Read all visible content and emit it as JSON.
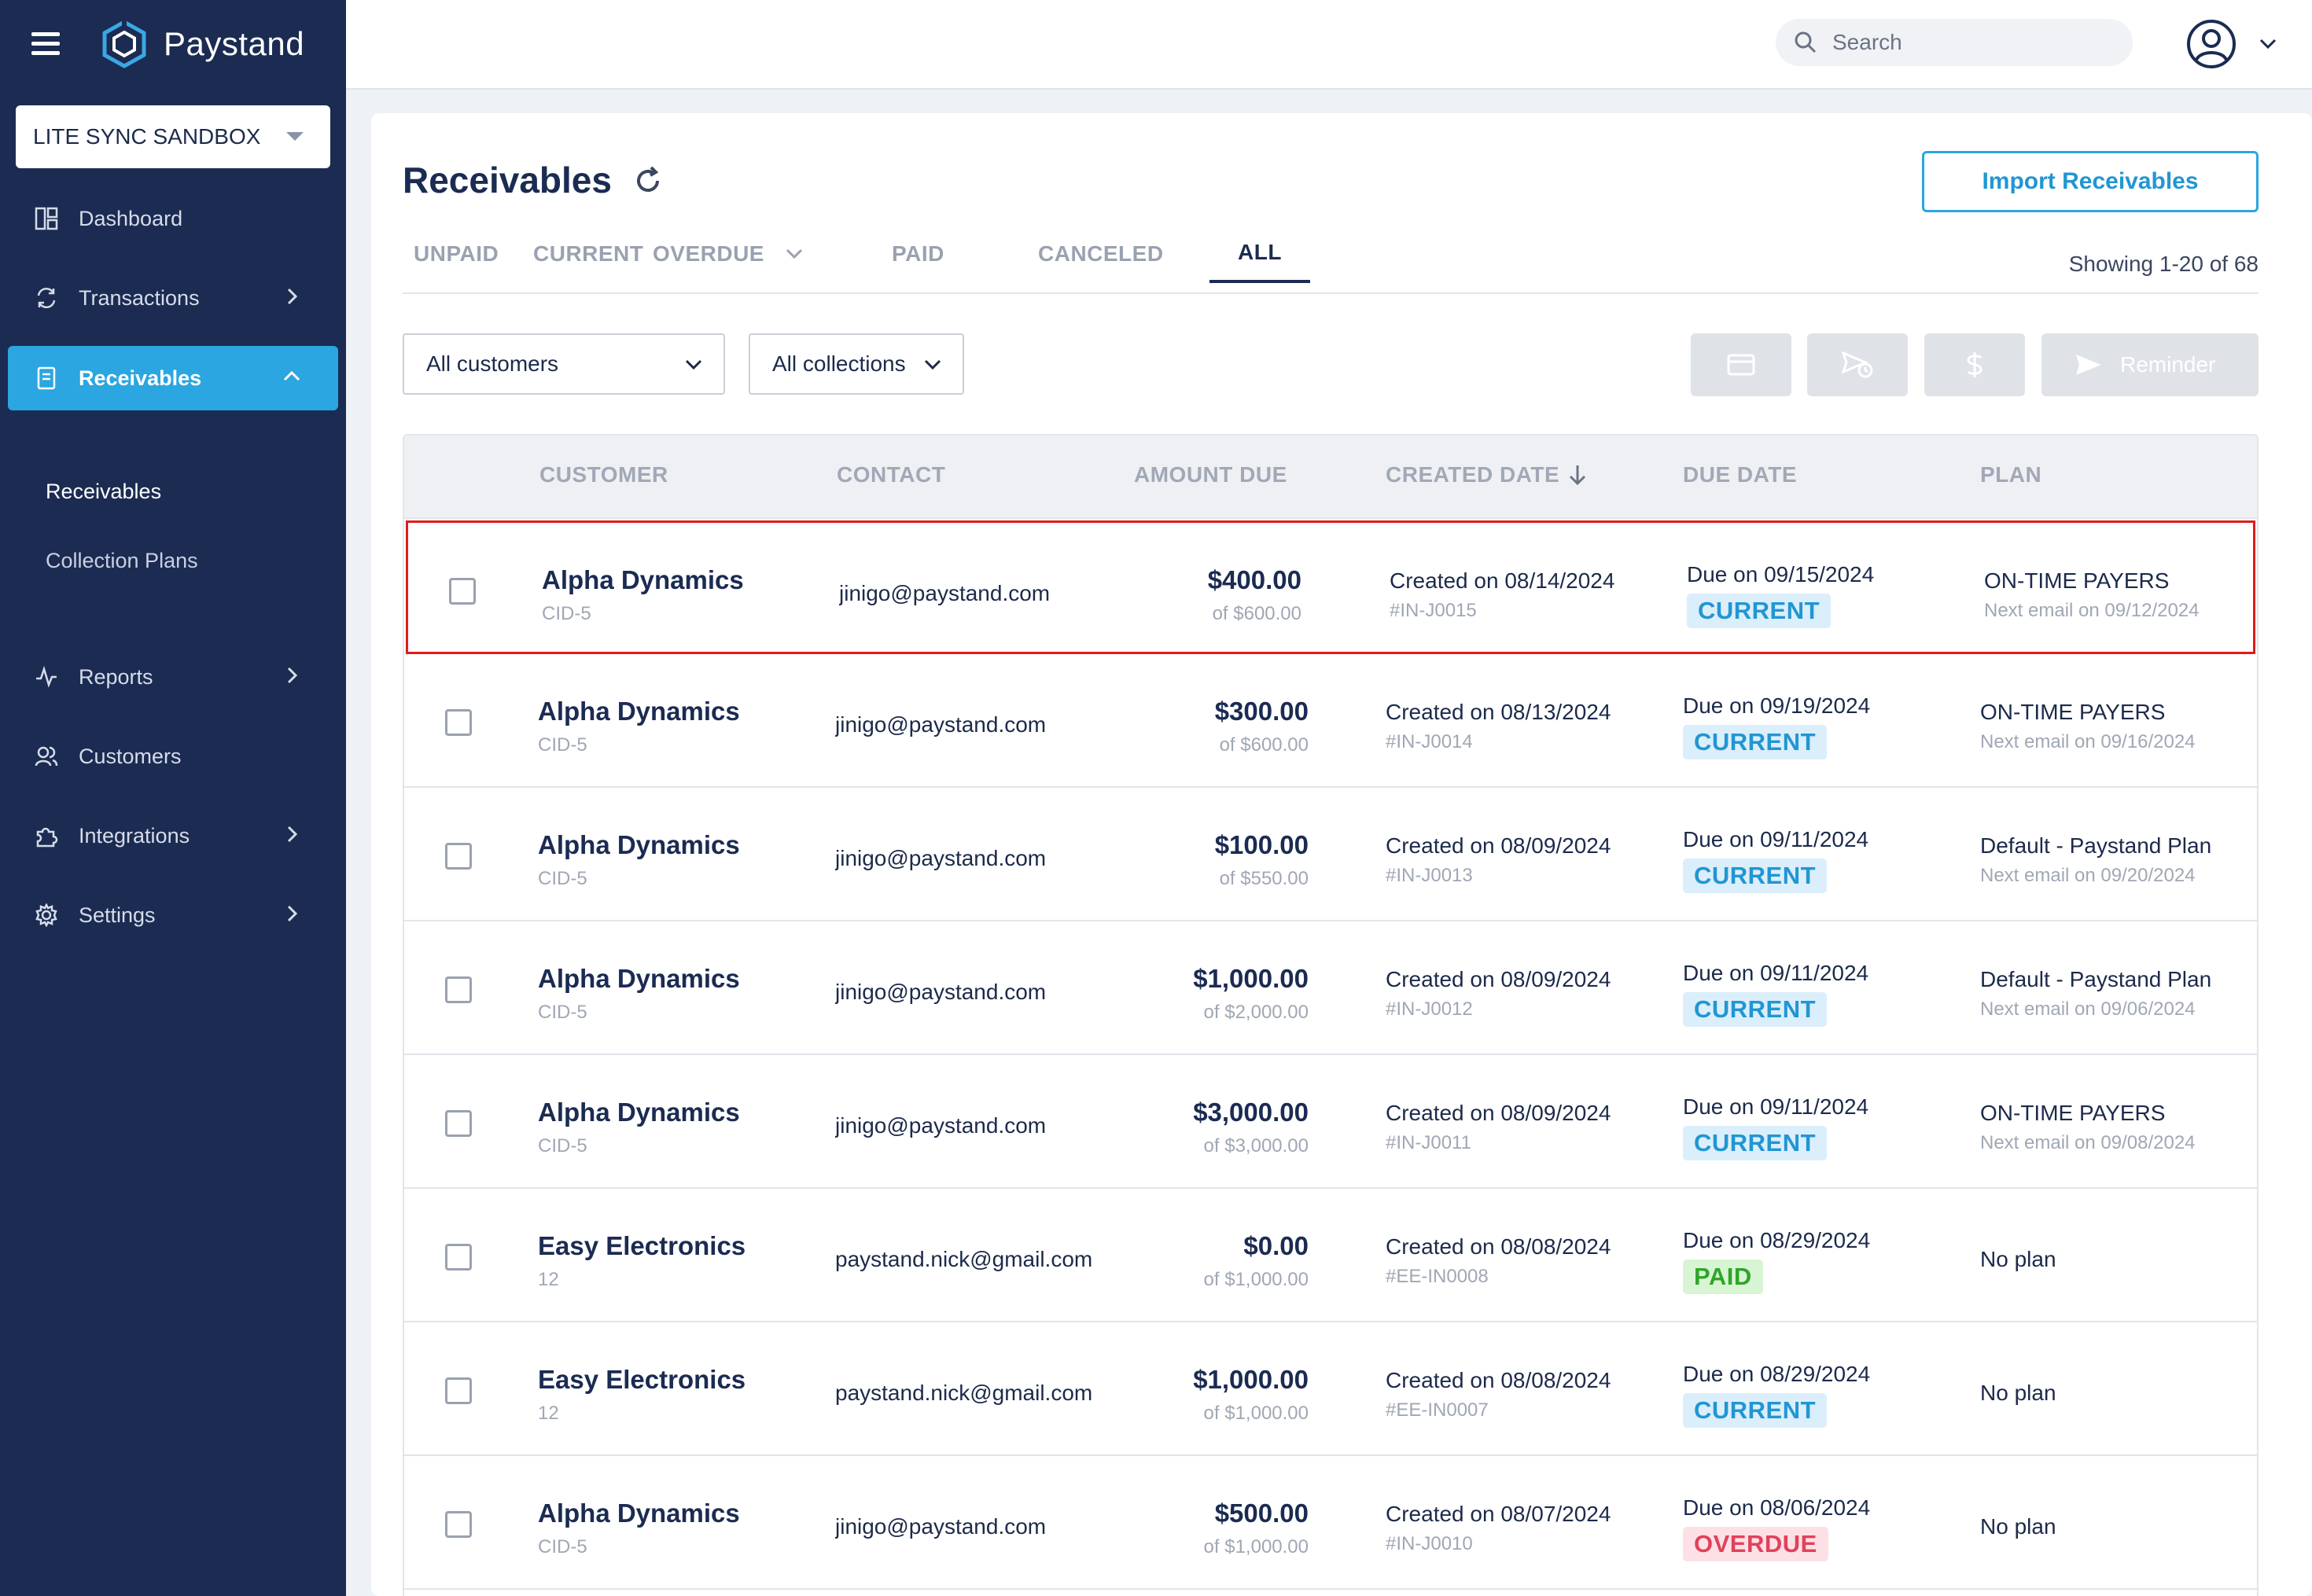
{
  "brand": {
    "name": "Paystand"
  },
  "org": {
    "selected": "LITE SYNC SANDBOX"
  },
  "nav": {
    "dashboard": "Dashboard",
    "transactions": "Transactions",
    "receivables": "Receivables",
    "sub_receivables": "Receivables",
    "sub_collection_plans": "Collection Plans",
    "reports": "Reports",
    "customers": "Customers",
    "integrations": "Integrations",
    "settings": "Settings"
  },
  "search": {
    "placeholder": "Search"
  },
  "page": {
    "title": "Receivables",
    "import_button": "Import Receivables",
    "showing": "Showing 1-20 of 68"
  },
  "tabs": [
    "UNPAID",
    "CURRENT",
    "OVERDUE",
    "PAID",
    "CANCELED",
    "ALL"
  ],
  "active_tab": "ALL",
  "filters": {
    "customers": "All customers",
    "collections": "All collections"
  },
  "actions": {
    "reminder": "Reminder"
  },
  "table": {
    "headers": {
      "customer": "CUSTOMER",
      "contact": "CONTACT",
      "amount_due": "AMOUNT DUE",
      "created_date": "CREATED DATE",
      "due_date": "DUE DATE",
      "plan": "PLAN"
    },
    "rows": [
      {
        "name": "Alpha Dynamics",
        "id": "CID-5",
        "contact": "jinigo@paystand.com",
        "amount": "$400.00",
        "of": "of $600.00",
        "created": "Created on 08/14/2024",
        "invoice": "#IN-J0015",
        "due": "Due on 09/15/2024",
        "status": "CURRENT",
        "plan": "ON-TIME PAYERS",
        "next": "Next email on 09/12/2024"
      },
      {
        "name": "Alpha Dynamics",
        "id": "CID-5",
        "contact": "jinigo@paystand.com",
        "amount": "$300.00",
        "of": "of $600.00",
        "created": "Created on 08/13/2024",
        "invoice": "#IN-J0014",
        "due": "Due on 09/19/2024",
        "status": "CURRENT",
        "plan": "ON-TIME PAYERS",
        "next": "Next email on 09/16/2024"
      },
      {
        "name": "Alpha Dynamics",
        "id": "CID-5",
        "contact": "jinigo@paystand.com",
        "amount": "$100.00",
        "of": "of $550.00",
        "created": "Created on 08/09/2024",
        "invoice": "#IN-J0013",
        "due": "Due on 09/11/2024",
        "status": "CURRENT",
        "plan": "Default - Paystand Plan",
        "next": "Next email on 09/20/2024"
      },
      {
        "name": "Alpha Dynamics",
        "id": "CID-5",
        "contact": "jinigo@paystand.com",
        "amount": "$1,000.00",
        "of": "of $2,000.00",
        "created": "Created on 08/09/2024",
        "invoice": "#IN-J0012",
        "due": "Due on 09/11/2024",
        "status": "CURRENT",
        "plan": "Default - Paystand Plan",
        "next": "Next email on 09/06/2024"
      },
      {
        "name": "Alpha Dynamics",
        "id": "CID-5",
        "contact": "jinigo@paystand.com",
        "amount": "$3,000.00",
        "of": "of $3,000.00",
        "created": "Created on 08/09/2024",
        "invoice": "#IN-J0011",
        "due": "Due on 09/11/2024",
        "status": "CURRENT",
        "plan": "ON-TIME PAYERS",
        "next": "Next email on 09/08/2024"
      },
      {
        "name": "Easy Electronics",
        "id": "12",
        "contact": "paystand.nick@gmail.com",
        "amount": "$0.00",
        "of": "of $1,000.00",
        "created": "Created on 08/08/2024",
        "invoice": "#EE-IN0008",
        "due": "Due on 08/29/2024",
        "status": "PAID",
        "plan": "No plan",
        "next": ""
      },
      {
        "name": "Easy Electronics",
        "id": "12",
        "contact": "paystand.nick@gmail.com",
        "amount": "$1,000.00",
        "of": "of $1,000.00",
        "created": "Created on 08/08/2024",
        "invoice": "#EE-IN0007",
        "due": "Due on 08/29/2024",
        "status": "CURRENT",
        "plan": "No plan",
        "next": ""
      },
      {
        "name": "Alpha Dynamics",
        "id": "CID-5",
        "contact": "jinigo@paystand.com",
        "amount": "$500.00",
        "of": "of $1,000.00",
        "created": "Created on 08/07/2024",
        "invoice": "#IN-J0010",
        "due": "Due on 08/06/2024",
        "status": "OVERDUE",
        "plan": "No plan",
        "next": ""
      }
    ]
  },
  "icons": {
    "menu": "hamburger-icon",
    "refresh": "refresh-icon",
    "search": "search-icon",
    "user": "user-avatar-icon"
  },
  "colors": {
    "sidebar": "#1b2b52",
    "accent": "#2ba6e0",
    "current": "#2196d3",
    "paid": "#2fa52a",
    "overdue": "#e0425b",
    "selection": "#e21b1b"
  }
}
